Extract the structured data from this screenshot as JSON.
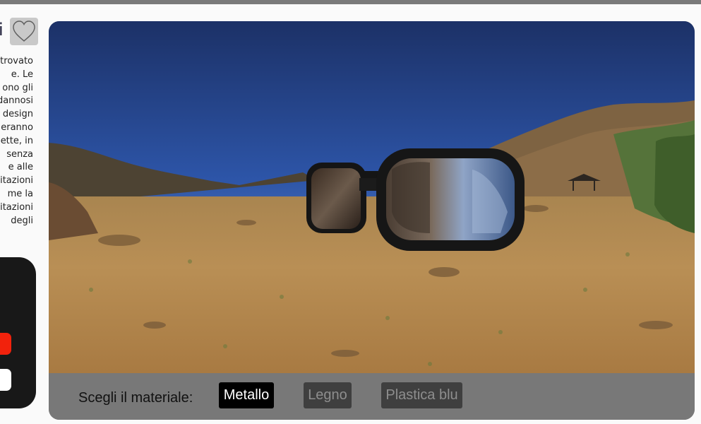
{
  "header": {
    "title_fragment": "i",
    "favorite_icon": "heart-outline-icon"
  },
  "description_lines": [
    "trovato",
    "e.  Le",
    "ono gli",
    "dannosi",
    "design",
    "eranno",
    "ette, in",
    "senza",
    "e  alle",
    "itazioni",
    "me  la",
    "itazioni",
    "degli"
  ],
  "viewer": {
    "scene": "3d-sunglasses-desert-panorama",
    "material_label": "Scegli il materiale:",
    "materials": [
      {
        "label": "Metallo",
        "selected": true
      },
      {
        "label": "Legno",
        "selected": false
      },
      {
        "label": "Plastica blu",
        "selected": false
      }
    ]
  },
  "colors": {
    "accent_red": "#f2220c",
    "active_button": "#000000",
    "controls_bar": "#787878"
  }
}
